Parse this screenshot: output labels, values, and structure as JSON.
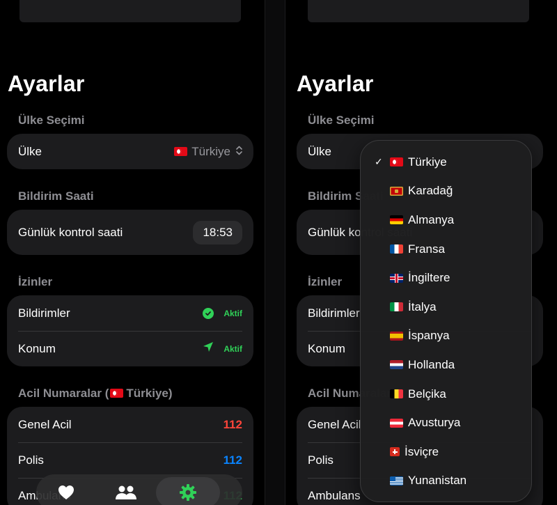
{
  "screen": {
    "title": "Ayarlar",
    "country_section": {
      "label": "Ülke Seçimi",
      "row_label": "Ülke",
      "selected_country": "Türkiye"
    },
    "notification_section": {
      "label": "Bildirim Saati",
      "row_label": "Günlük kontrol saati",
      "time": "18:53"
    },
    "permissions_section": {
      "label": "İzinler",
      "items": [
        {
          "label": "Bildirimler",
          "status": "Aktif",
          "icon": "check-circle-icon"
        },
        {
          "label": "Konum",
          "status": "Aktif",
          "icon": "location-arrow-icon"
        }
      ]
    },
    "emergency_section": {
      "label_prefix": "Acil Numaralar (",
      "label_country": "Türkiye",
      "label_suffix": ")",
      "items": [
        {
          "label": "Genel Acil",
          "number": "112",
          "color": "#ff453a"
        },
        {
          "label": "Polis",
          "number": "112",
          "color": "#0a84ff"
        },
        {
          "label": "Ambulans",
          "number": "112",
          "color": "#30d158"
        }
      ]
    },
    "tabbar": {
      "tabs": [
        {
          "icon": "heart-icon",
          "active": false
        },
        {
          "icon": "people-icon",
          "active": false
        },
        {
          "icon": "gear-icon",
          "active": true
        }
      ]
    }
  },
  "country_menu": {
    "options": [
      {
        "label": "Türkiye",
        "flag": "tr",
        "selected": true
      },
      {
        "label": "Karadağ",
        "flag": "me",
        "selected": false
      },
      {
        "label": "Almanya",
        "flag": "de",
        "selected": false
      },
      {
        "label": "Fransa",
        "flag": "fr",
        "selected": false
      },
      {
        "label": "İngiltere",
        "flag": "gb",
        "selected": false
      },
      {
        "label": "İtalya",
        "flag": "it",
        "selected": false
      },
      {
        "label": "İspanya",
        "flag": "es",
        "selected": false
      },
      {
        "label": "Hollanda",
        "flag": "nl",
        "selected": false
      },
      {
        "label": "Belçika",
        "flag": "be",
        "selected": false
      },
      {
        "label": "Avusturya",
        "flag": "at",
        "selected": false
      },
      {
        "label": "İsviçre",
        "flag": "ch",
        "selected": false
      },
      {
        "label": "Yunanistan",
        "flag": "gr",
        "selected": false
      }
    ]
  },
  "colors": {
    "accent_green": "#30d158",
    "emergency_red": "#ff453a",
    "police_blue": "#0a84ff",
    "card": "#1c1c1e"
  }
}
